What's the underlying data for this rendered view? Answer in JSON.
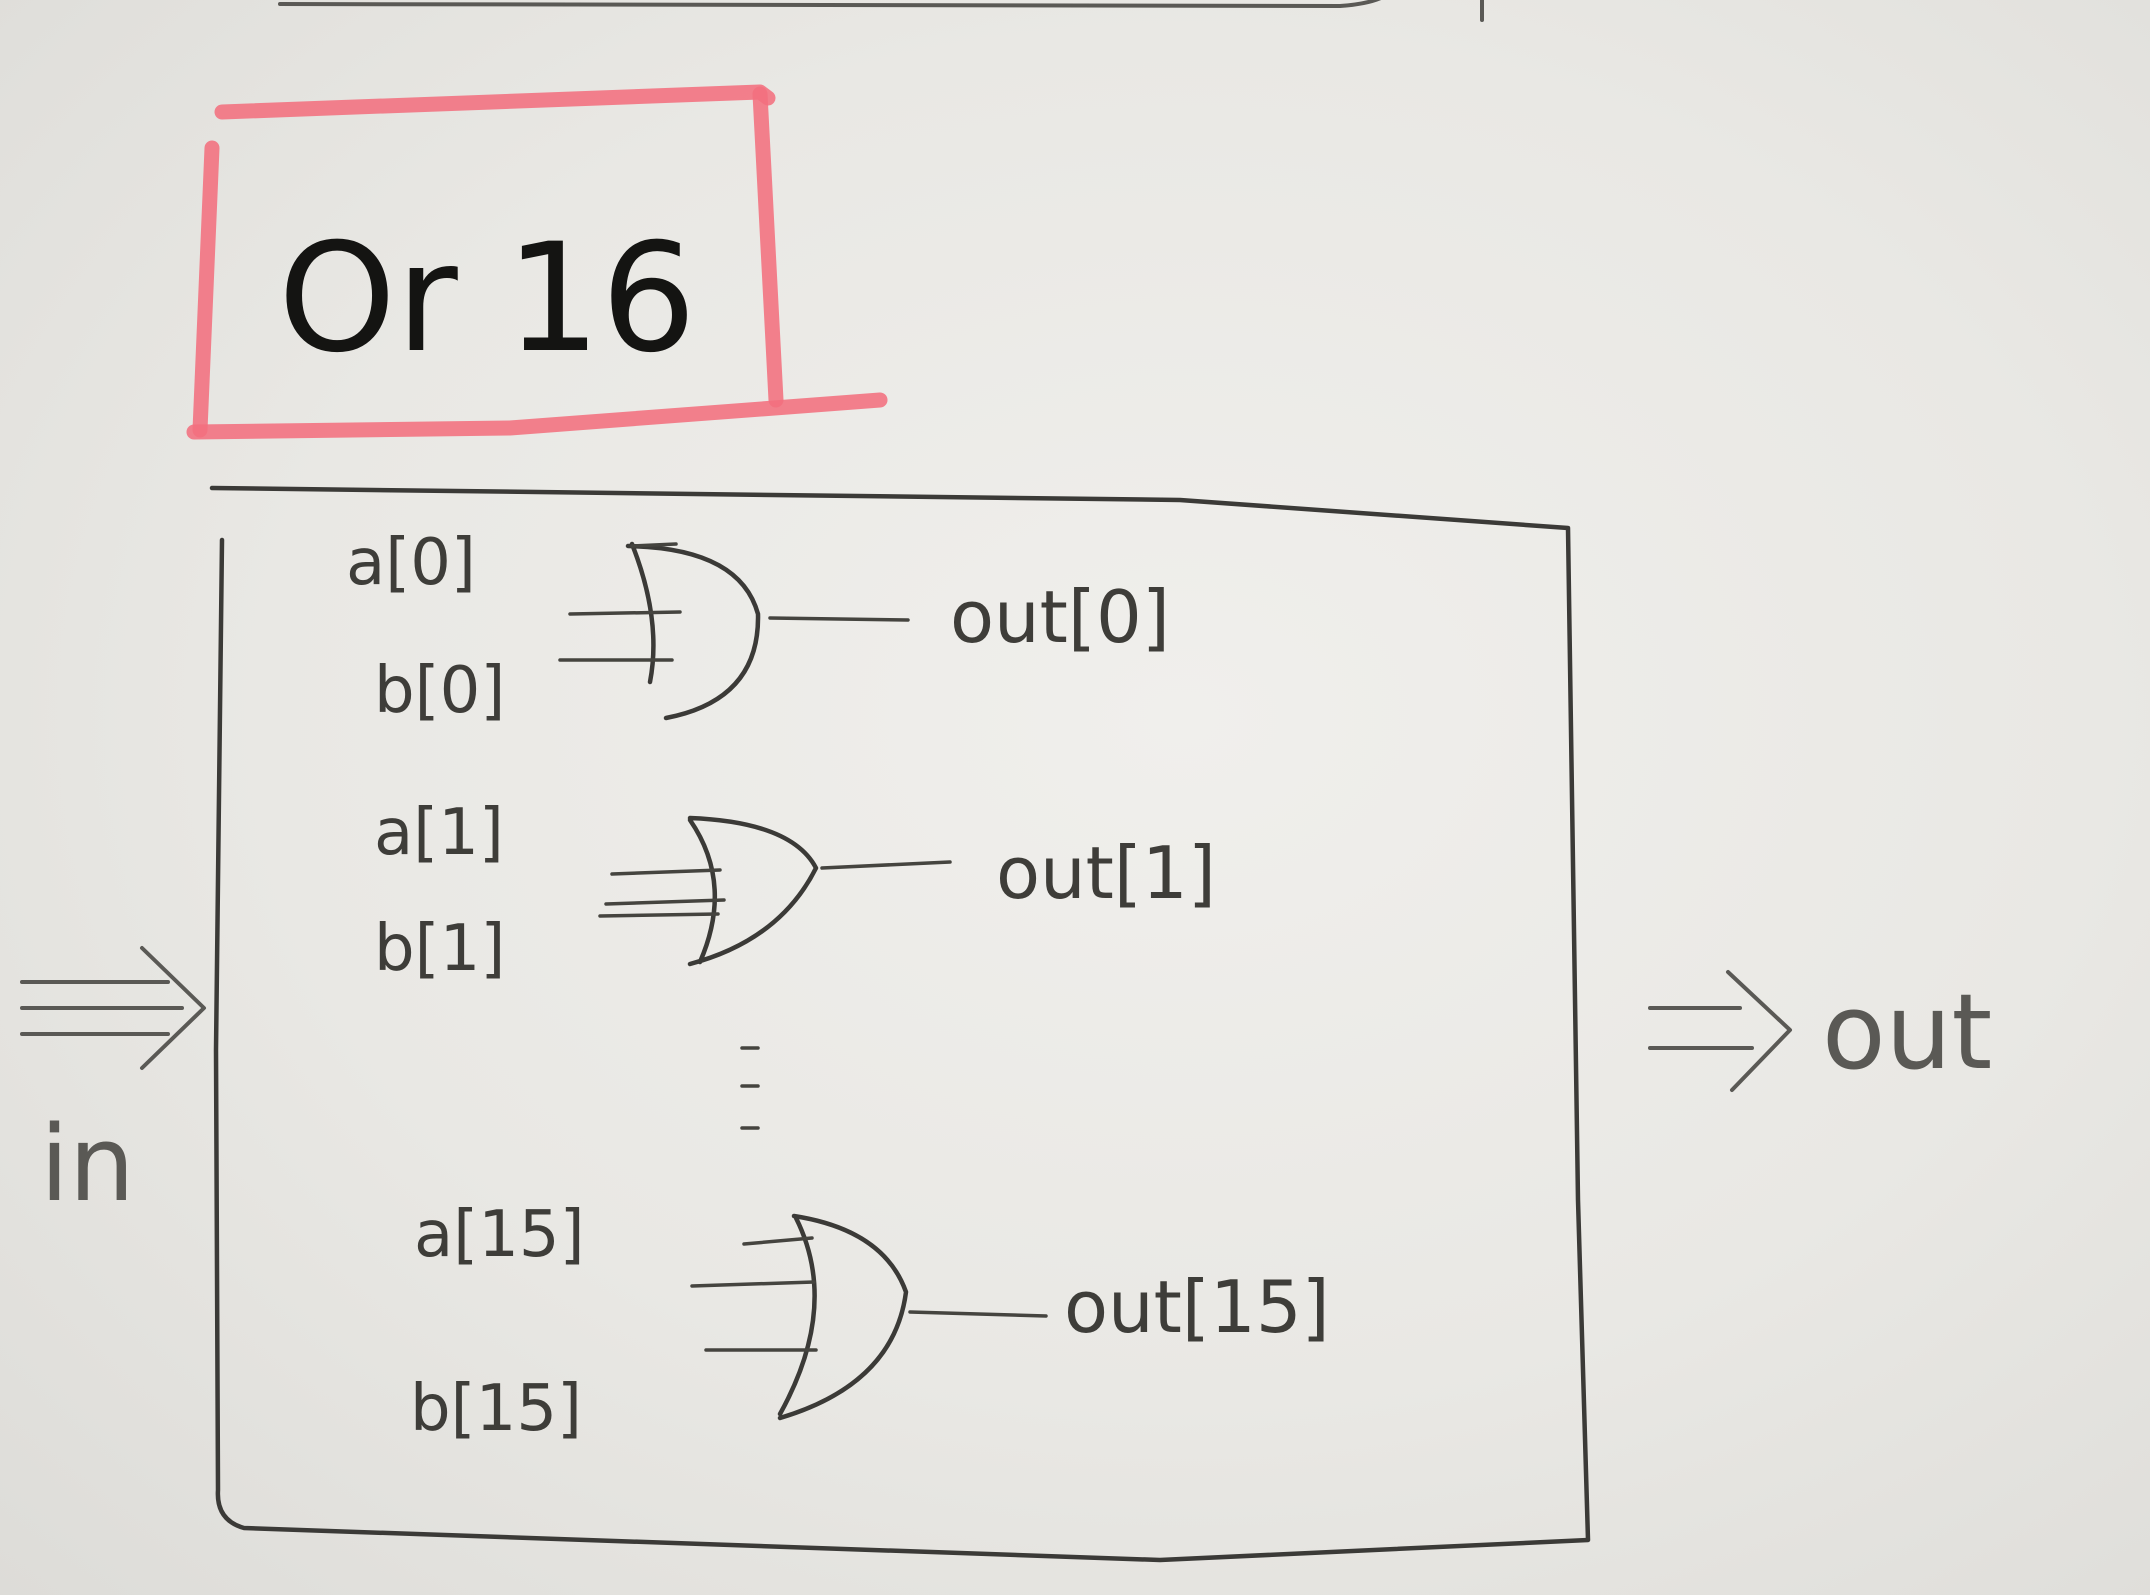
{
  "diagram": {
    "title": "Or 16",
    "input_label": "in",
    "output_label": "out",
    "ellipsis": "⋮",
    "gates": [
      {
        "a": "a[0]",
        "b": "b[0]",
        "out": "out[0]"
      },
      {
        "a": "a[1]",
        "b": "b[1]",
        "out": "out[1]"
      },
      {
        "a": "a[15]",
        "b": "b[15]",
        "out": "out[15]"
      }
    ],
    "colors": {
      "highlighter": "#f2707e",
      "ink": "#3b3a37",
      "paper": "#eceae6"
    }
  }
}
